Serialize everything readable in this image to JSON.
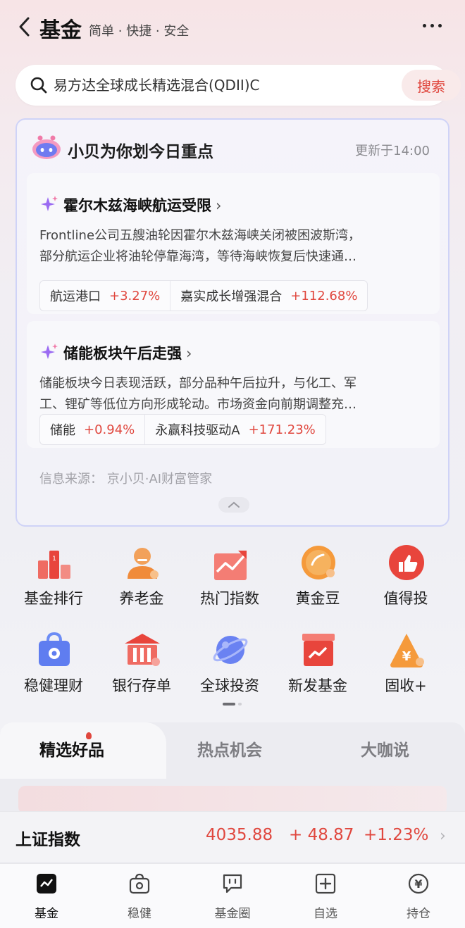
{
  "header": {
    "title": "基金",
    "slogan": "简单 · 快捷 · 安全"
  },
  "search": {
    "placeholder": "易方达全球成长精选混合(QDII)C",
    "button_label": "搜索"
  },
  "ai_card": {
    "title": "小贝为你划今日重点",
    "updated": "更新于14:00",
    "topics": [
      {
        "title": "霍尔木兹海峡航运受限",
        "line1": "Frontline公司五艘油轮因霍尔木兹海峡关闭被困波斯湾，",
        "line2": "部分航运企业将油轮停靠海湾，等待海峡恢复后快速通…",
        "chips": [
          {
            "name": "航运港口",
            "pct": "+3.27%"
          },
          {
            "name": "嘉实成长增强混合",
            "pct": "+112.68%"
          }
        ]
      },
      {
        "title": "储能板块午后走强",
        "line1": "储能板块今日表现活跃，部分品种午后拉升，与化工、军",
        "line2": "工、锂矿等低位方向形成轮动。市场资金向前期调整充…",
        "chips": [
          {
            "name": "储能",
            "pct": "+0.94%"
          },
          {
            "name": "永赢科技驱动A",
            "pct": "+171.23%"
          }
        ]
      }
    ],
    "source": "信息来源： 京小贝·AI财富管家"
  },
  "grid": {
    "items": [
      {
        "label": "基金排行",
        "icon": "ranking-icon"
      },
      {
        "label": "养老金",
        "icon": "pension-icon"
      },
      {
        "label": "热门指数",
        "icon": "index-chart-icon"
      },
      {
        "label": "黄金豆",
        "icon": "gold-bean-icon"
      },
      {
        "label": "值得投",
        "icon": "thumbs-up-icon"
      },
      {
        "label": "稳健理财",
        "icon": "safe-bag-icon"
      },
      {
        "label": "银行存单",
        "icon": "bank-icon"
      },
      {
        "label": "全球投资",
        "icon": "globe-icon"
      },
      {
        "label": "新发基金",
        "icon": "new-fund-icon"
      },
      {
        "label": "固收+",
        "icon": "fixed-income-icon"
      }
    ]
  },
  "section_tabs": {
    "tab1": "精选好品",
    "tab2": "热点机会",
    "tab3": "大咖说"
  },
  "ticker": {
    "name": "上证指数",
    "value": "4035.88",
    "change": "+ 48.87",
    "percent": "+1.23%"
  },
  "bottom_nav": {
    "items": [
      {
        "label": "基金",
        "icon": "fund-chart-icon"
      },
      {
        "label": "稳健",
        "icon": "steady-bag-icon"
      },
      {
        "label": "基金圈",
        "icon": "chat-icon"
      },
      {
        "label": "自选",
        "icon": "plus-square-icon"
      },
      {
        "label": "持仓",
        "icon": "yen-icon"
      }
    ]
  },
  "colors": {
    "accent_red": "#e0473e",
    "card_border": "#cfd3f7"
  }
}
